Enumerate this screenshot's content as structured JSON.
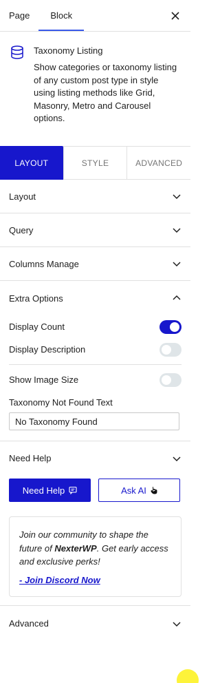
{
  "top_tabs": {
    "page": "Page",
    "block": "Block"
  },
  "block": {
    "title": "Taxonomy Listing",
    "description": "Show categories or taxonomy listing of any custom post type in style using listing methods like Grid, Masonry, Metro and Carousel options."
  },
  "style_tabs": {
    "layout": "LAYOUT",
    "style": "STYLE",
    "advanced": "ADVANCED"
  },
  "panels": {
    "layout": "Layout",
    "query": "Query",
    "columns": "Columns Manage",
    "extra": "Extra Options",
    "need_help": "Need Help",
    "advanced": "Advanced"
  },
  "extra_options": {
    "display_count": {
      "label": "Display Count",
      "enabled": true
    },
    "display_description": {
      "label": "Display Description",
      "enabled": false
    },
    "show_image_size": {
      "label": "Show Image Size",
      "enabled": false
    },
    "not_found_label": "Taxonomy Not Found Text",
    "not_found_value": "No Taxonomy Found"
  },
  "help": {
    "need_help_button": "Need Help",
    "ask_ai_button": "Ask AI",
    "community_prefix": "Join our community to shape the future of ",
    "brand": "NexterWP",
    "community_suffix": ". Get early access and exclusive perks!",
    "discord_link": "- Join Discord Now"
  },
  "colors": {
    "accent": "#1717cc",
    "tab_underline": "#3858e9",
    "badge": "#fdf33a"
  }
}
